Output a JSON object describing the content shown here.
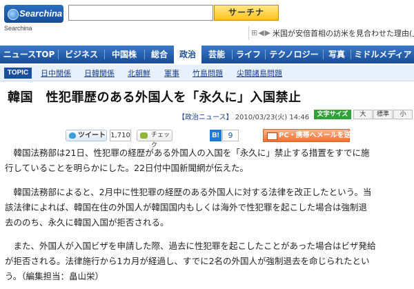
{
  "header": {
    "logo_text": "Searchina",
    "logo_sub": "Searchina",
    "search_placeholder": "",
    "search_button": "サーチナ",
    "ticker_arrows": "⊞◀▶",
    "ticker_text": "米国が安倍首相の訪米を見合わせた理由(上)"
  },
  "nav": {
    "items": [
      {
        "label": "ニュースTOP"
      },
      {
        "label": "ビジネス"
      },
      {
        "label": "中国株"
      },
      {
        "label": "総合"
      },
      {
        "label": "政治"
      },
      {
        "label": "芸能"
      },
      {
        "label": "ライフ"
      },
      {
        "label": "テクノロジー"
      },
      {
        "label": "写真"
      },
      {
        "label": "ミドルメディア"
      }
    ],
    "active": "政治"
  },
  "topics": {
    "badge": "TOPIC",
    "links": [
      "日中関係",
      "日韓関係",
      "北朝鮮",
      "軍事",
      "竹島問題",
      "尖閣諸島問題"
    ]
  },
  "article": {
    "title": "韓国　性犯罪歴のある外国人を「永久に」入国禁止",
    "category": "【政治ニュース】",
    "date": "2010/03/23(火)",
    "time": "14:46",
    "paragraphs": [
      [
        "　韓国法務部は21日、性犯罪の経歴がある外国人の入国を「永久に」禁止する措置をすでに施",
        "行していることを明らかにした。22日付中国新聞網が伝えた。"
      ],
      [
        "　韓国法務部によると、2月中に性犯罪の経歴のある外国人に対する法律を改正したという。当",
        "該法律によれば、韓国在住の外国人が韓国国内もしくは海外で性犯罪を起こした場合は強制退",
        "去ののち、永久に韓国入国が拒否される。"
      ],
      [
        "　また、外国人が入国ビザを申請した際、過去に性犯罪を起こしたことがあった場合はビザ発給",
        "が拒否される。法律施行から1カ月が経過し、すでに2名の外国人が強制退去を命じられたとい",
        "う。（編集担当：畠山栄）"
      ]
    ]
  },
  "font_size": {
    "label": "文字サイズ",
    "large": "大",
    "standard": "標準",
    "small": "小"
  },
  "share": {
    "tweet_label": "ツイート",
    "tweet_count": "1,710",
    "check_label": "チェック",
    "hatena_label": "B!",
    "hatena_count": "9",
    "mail_label": "PC・携帯へメールを送る"
  },
  "colors": {
    "nav_blue": "#1a4f9a",
    "search_orange": "#ffc21a",
    "font_size_green": "#31a13a",
    "mail_orange": "#f07034"
  }
}
